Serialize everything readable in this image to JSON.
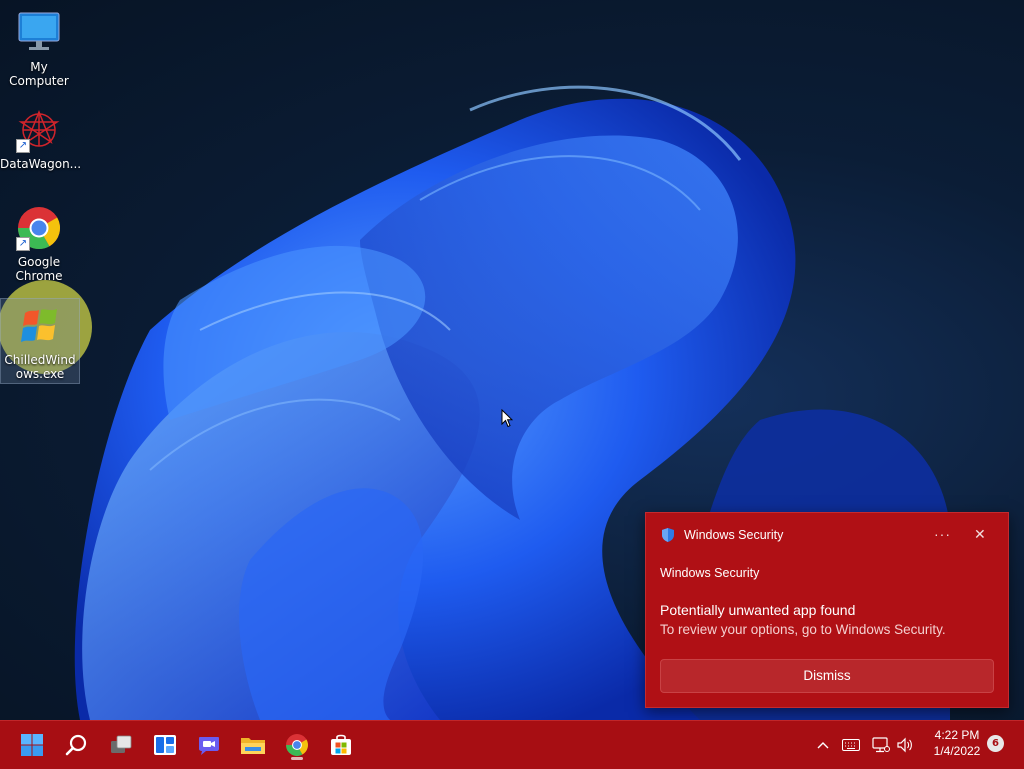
{
  "desktop": {
    "icons": [
      {
        "label": "My Computer"
      },
      {
        "label": "DataWagon..."
      },
      {
        "label": "Google Chrome"
      },
      {
        "label": "ChilledWindows.exe"
      }
    ]
  },
  "toast": {
    "app_name": "Windows Security",
    "more_label": "···",
    "close_label": "✕",
    "source": "Windows Security",
    "title": "Potentially unwanted app found",
    "body": "To review your options, go to Windows Security.",
    "dismiss_label": "Dismiss"
  },
  "taskbar": {
    "apps": [
      "start-icon",
      "search-icon",
      "task-view-icon",
      "widgets-icon",
      "chat-icon",
      "file-explorer-icon",
      "chrome-icon",
      "store-icon"
    ],
    "tray": {
      "chevron": "^"
    },
    "clock": {
      "time": "4:22 PM",
      "date": "1/4/2022"
    },
    "notification_count": "6"
  },
  "colors": {
    "taskbar": "#a70e13",
    "toast": "#b01015",
    "accent": "#1a4dff"
  }
}
